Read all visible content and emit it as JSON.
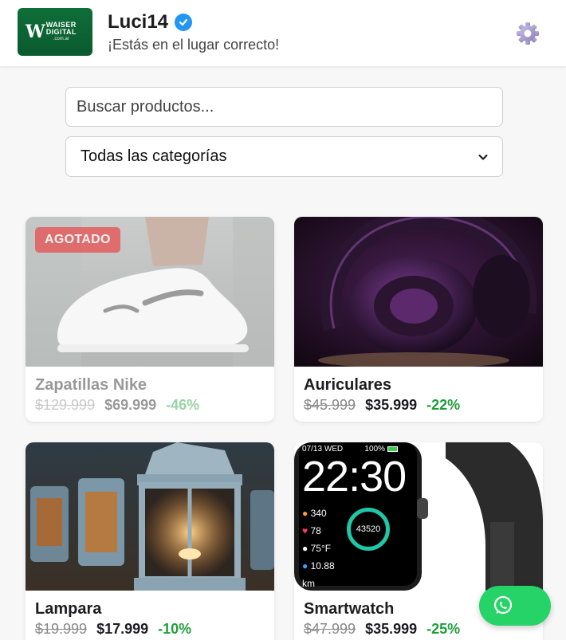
{
  "header": {
    "logo": {
      "mark": "W",
      "line1": "WAISER",
      "line2": "DIGITAL",
      "line3": ".com.ar"
    },
    "store_name": "Luci14",
    "tagline": "¡Estás en el lugar correcto!",
    "settings_icon": "gear-icon",
    "verified_icon": "verified-check-icon"
  },
  "filters": {
    "search_placeholder": "Buscar productos...",
    "category_selected": "Todas las categorías"
  },
  "products": [
    {
      "name": "Zapatillas Nike",
      "old_price": "$129.999",
      "price": "$69.999",
      "discount": "-46%",
      "badge": "AGOTADO",
      "sold_out": true
    },
    {
      "name": "Auriculares",
      "old_price": "$45.999",
      "price": "$35.999",
      "discount": "-22%",
      "sold_out": false
    },
    {
      "name": "Lampara",
      "old_price": "$19.999",
      "price": "$17.999",
      "discount": "-10%",
      "sold_out": false
    },
    {
      "name": "Smartwatch",
      "old_price": "$47.999",
      "price": "$35.999",
      "discount": "-25%",
      "sold_out": false
    }
  ],
  "watch_screen": {
    "date": "07/13",
    "day": "WED",
    "battery": "100%",
    "time": "22:30",
    "stat1": "340",
    "stat2": "78",
    "stat3": "75°F",
    "stat4": "10.88 km",
    "ring_value": "43520"
  },
  "whatsapp_icon": "whatsapp-icon",
  "colors": {
    "brand_green": "#0e6e38",
    "discount_green": "#1e9e3a",
    "soldout_red": "#e84f4f",
    "whatsapp": "#25d366",
    "verified_blue": "#2196f3"
  }
}
